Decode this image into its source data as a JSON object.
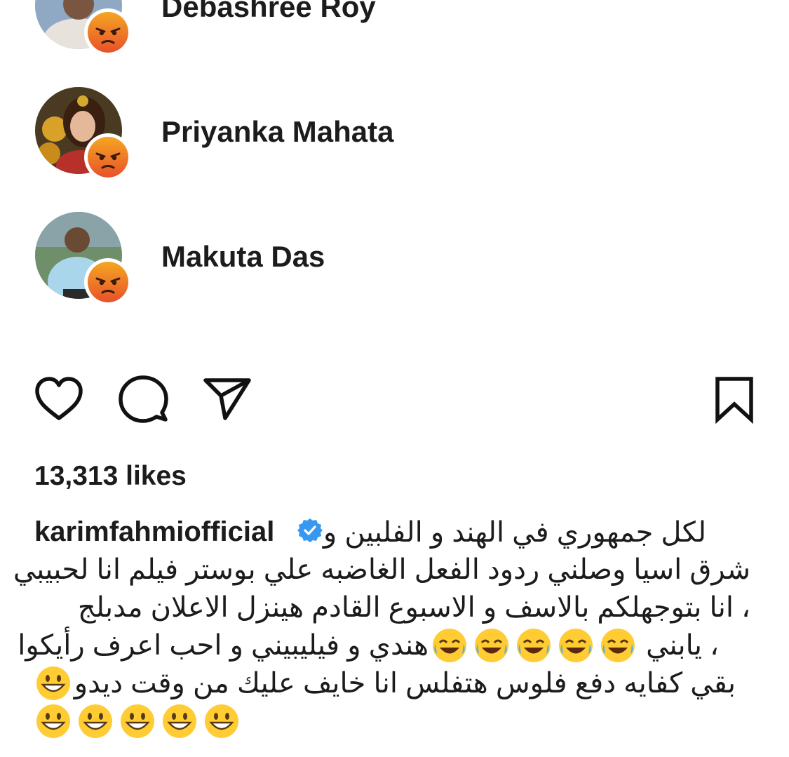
{
  "reactions": [
    {
      "name": "Debashree Roy",
      "reaction": "angry-icon"
    },
    {
      "name": "Priyanka Mahata",
      "reaction": "angry-icon"
    },
    {
      "name": "Makuta Das",
      "reaction": "angry-icon"
    }
  ],
  "actions": {
    "like": "heart-icon",
    "comment": "comment-icon",
    "share": "send-icon",
    "save": "bookmark-icon"
  },
  "likes_label": "13,313 likes",
  "post": {
    "username": "karimfahmiofficial",
    "verified": true,
    "caption_lines": [
      "لكل جمهوري في الهند و الفلبين و",
      "شرق اسيا وصلني ردود الفعل الغاضبه علي بوستر فيلم انا لحبيبي",
      "، انا بتوجهلكم بالاسف و الاسبوع القادم هينزل الاعلان مدبلج",
      "هندي و فيليبيني و احب اعرف رأيكوا",
      "، يابني",
      "بقي كفايه دفع فلوس هتفلس انا خايف عليك من وقت ديدو"
    ],
    "laughing_emoji_count": 5,
    "grinning_emoji_count_end": 5
  },
  "colors": {
    "angry_top": "#f5a623",
    "angry_bottom": "#e8512a",
    "verified_blue": "#3897f0",
    "emoji_yellow": "#ffcc33"
  }
}
